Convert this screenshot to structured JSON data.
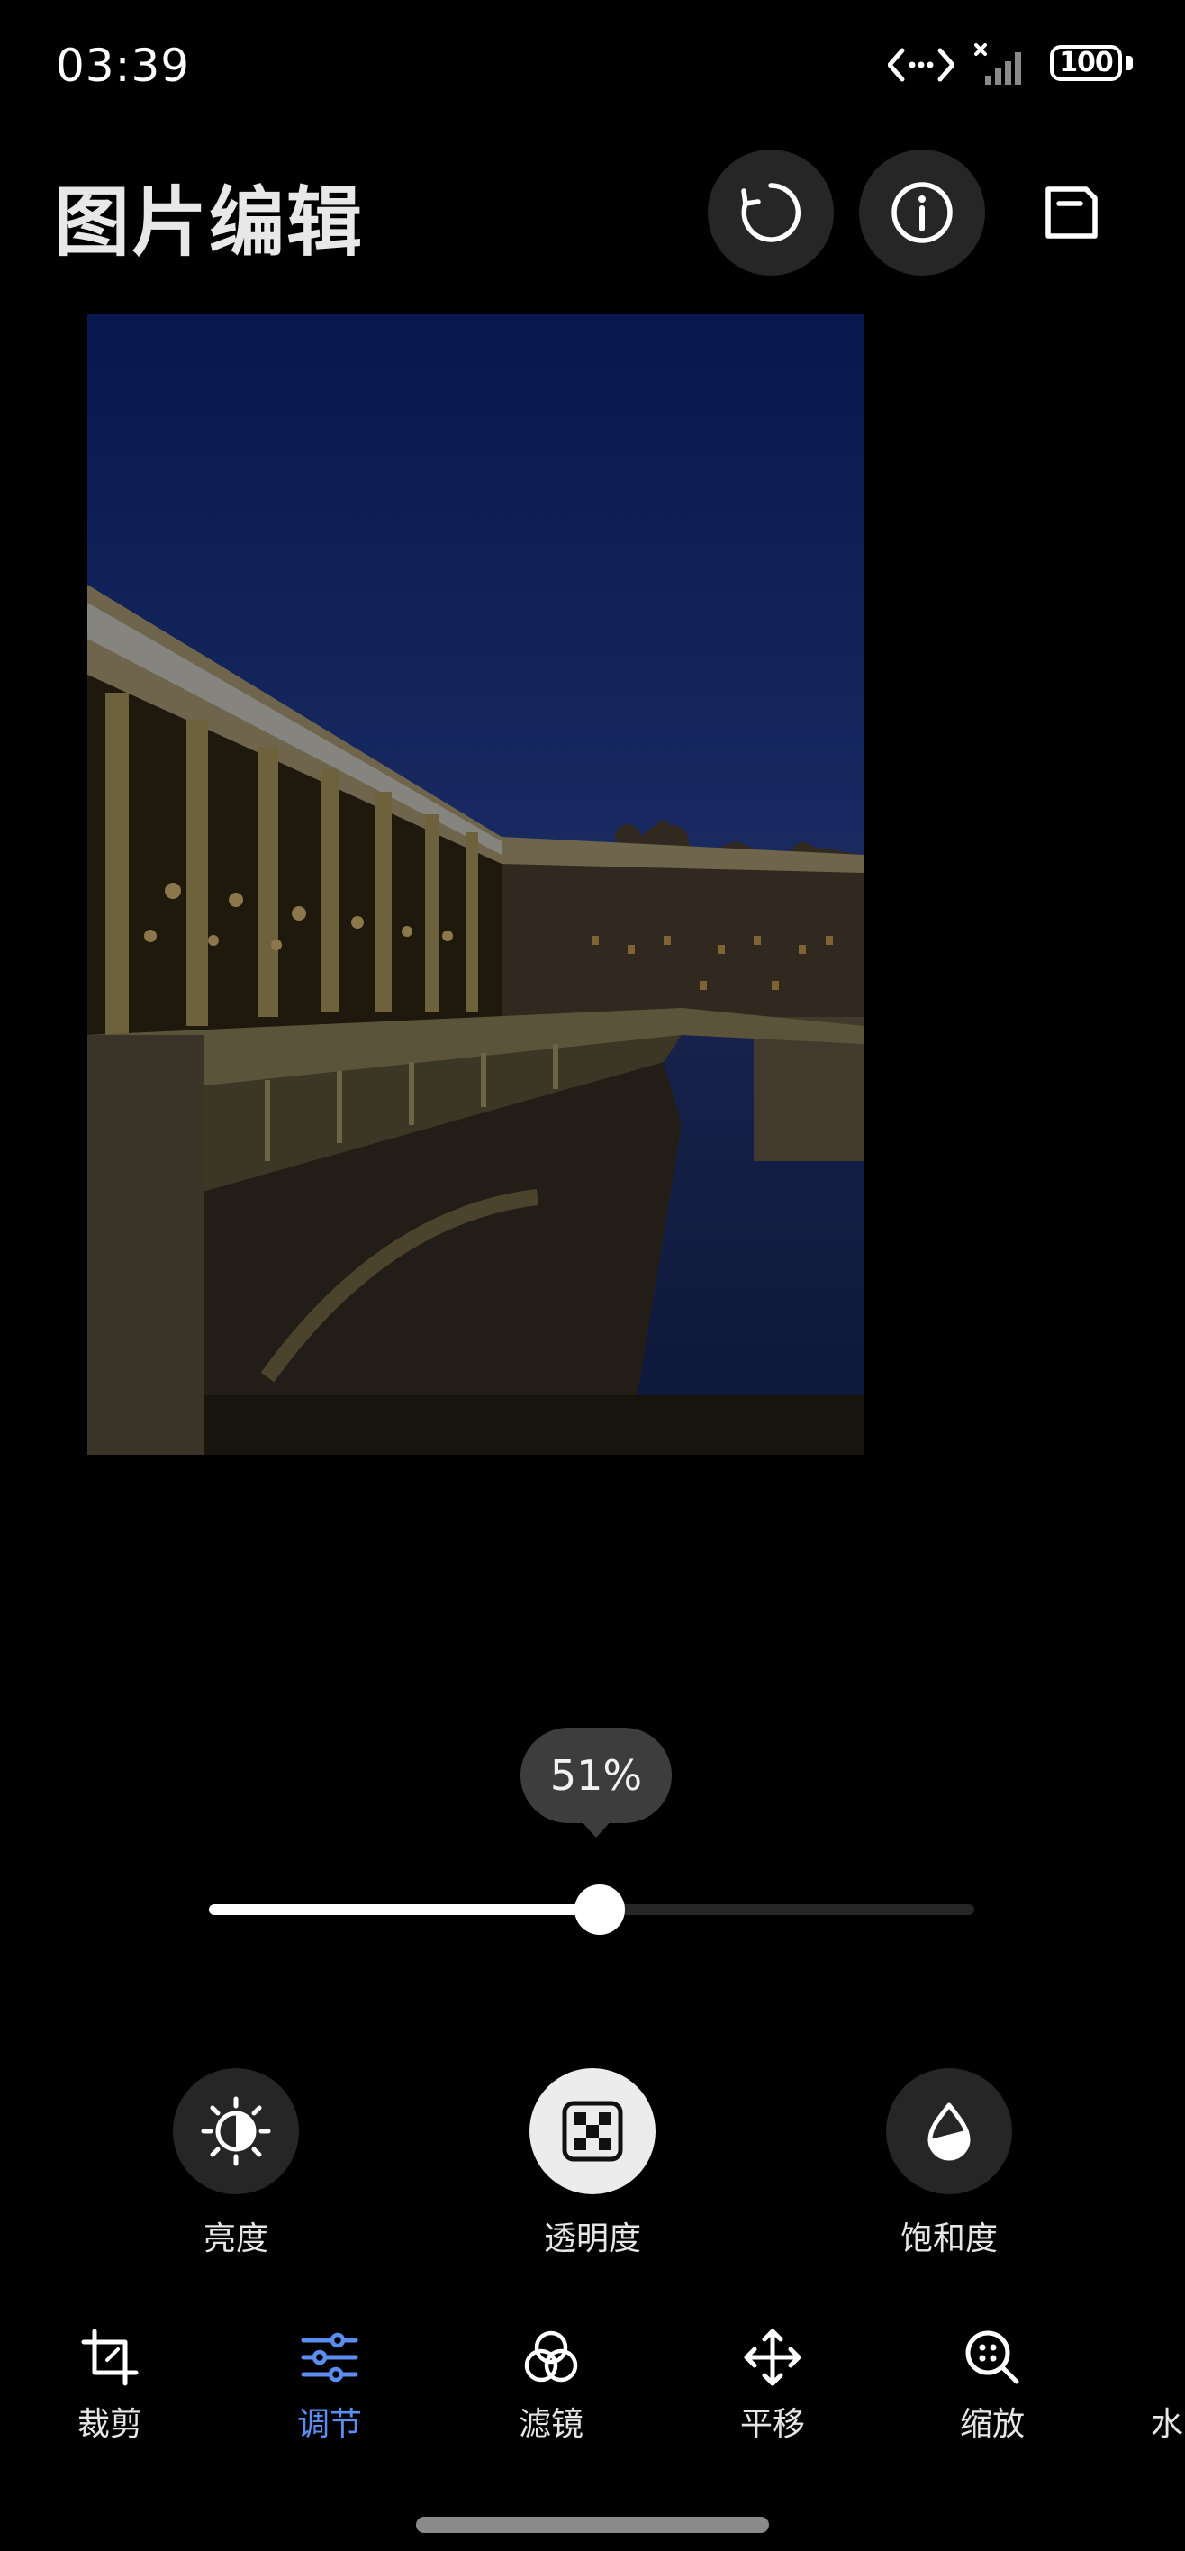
{
  "status": {
    "time": "03:39",
    "battery": "100"
  },
  "header": {
    "title": "图片编辑"
  },
  "slider": {
    "value_label": "51%",
    "value": 0.51
  },
  "tools": [
    {
      "label": "亮度",
      "icon": "brightness-icon",
      "active": false
    },
    {
      "label": "透明度",
      "icon": "transparency-icon",
      "active": true
    },
    {
      "label": "饱和度",
      "icon": "saturation-icon",
      "active": false
    }
  ],
  "nav": [
    {
      "label": "裁剪",
      "icon": "crop-icon",
      "active": false
    },
    {
      "label": "调节",
      "icon": "adjust-icon",
      "active": true
    },
    {
      "label": "滤镜",
      "icon": "filter-icon",
      "active": false
    },
    {
      "label": "平移",
      "icon": "move-icon",
      "active": false
    },
    {
      "label": "缩放",
      "icon": "zoom-icon",
      "active": false
    },
    {
      "label": "水",
      "icon": "watermark-icon",
      "active": false
    }
  ],
  "colors": {
    "accent": "#5b8ef0",
    "button_bg": "#262626",
    "active_tool_bg": "#ececec"
  }
}
